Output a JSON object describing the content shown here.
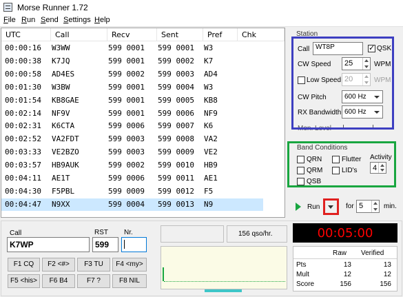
{
  "window": {
    "title": "Morse Runner 1.72"
  },
  "menu": [
    "File",
    "Run",
    "Send",
    "Settings",
    "Help"
  ],
  "log": {
    "columns": [
      "UTC",
      "Call",
      "Recv",
      "Sent",
      "Pref",
      "Chk"
    ],
    "rows": [
      [
        "00:00:16",
        "W3WW",
        "599 0001",
        "599 0001",
        "W3",
        ""
      ],
      [
        "00:00:38",
        "K7JQ",
        "599 0001",
        "599 0002",
        "K7",
        ""
      ],
      [
        "00:00:58",
        "AD4ES",
        "599 0002",
        "599 0003",
        "AD4",
        ""
      ],
      [
        "00:01:30",
        "W3BW",
        "599 0001",
        "599 0004",
        "W3",
        ""
      ],
      [
        "00:01:54",
        "KB8GAE",
        "599 0001",
        "599 0005",
        "KB8",
        ""
      ],
      [
        "00:02:14",
        "NF9V",
        "599 0001",
        "599 0006",
        "NF9",
        ""
      ],
      [
        "00:02:31",
        "K6CTA",
        "599 0006",
        "599 0007",
        "K6",
        ""
      ],
      [
        "00:02:52",
        "VA2FDT",
        "599 0003",
        "599 0008",
        "VA2",
        ""
      ],
      [
        "00:03:33",
        "VE2BZO",
        "599 0003",
        "599 0009",
        "VE2",
        ""
      ],
      [
        "00:03:57",
        "HB9AUK",
        "599 0002",
        "599 0010",
        "HB9",
        ""
      ],
      [
        "00:04:11",
        "AE1T",
        "599 0006",
        "599 0011",
        "AE1",
        ""
      ],
      [
        "00:04:30",
        "F5PBL",
        "599 0009",
        "599 0012",
        "F5",
        ""
      ],
      [
        "00:04:47",
        "N9XX",
        "599 0004",
        "599 0013",
        "N9",
        ""
      ]
    ]
  },
  "station": {
    "group_label": "Station",
    "call_label": "Call",
    "call_value": "WT8P",
    "qsk_label": "QSK",
    "qsk_checked": true,
    "cw_speed_label": "CW Speed",
    "cw_speed_value": "25",
    "wpm_label": "WPM",
    "low_speed_label": "Low Speed",
    "low_speed_checked": false,
    "low_speed_value": "20",
    "low_wpm_label": "WPM",
    "cw_pitch_label": "CW Pitch",
    "cw_pitch_value": "600 Hz",
    "rx_bw_label": "RX Bandwidth",
    "rx_bw_value": "600 Hz",
    "mon_level_label": "Mon. Level"
  },
  "band": {
    "group_label": "Band Conditions",
    "qrn_label": "QRN",
    "qrm_label": "QRM",
    "qsb_label": "QSB",
    "flutter_label": "Flutter",
    "lids_label": "LID's",
    "activity_label": "Activity",
    "activity_value": "4"
  },
  "run": {
    "run_label": "Run",
    "for_label": "for",
    "minutes_value": "5",
    "min_label": "min."
  },
  "entry": {
    "call_label": "Call",
    "call_value": "K7WP",
    "rst_label": "RST",
    "rst_value": "599",
    "nr_label": "Nr.",
    "nr_value": ""
  },
  "fkeys": [
    "F1 CQ",
    "F2 <#>",
    "F3 TU",
    "F4 <my>",
    "F5 <his>",
    "F6 B4",
    "F7 ?",
    "F8 NIL"
  ],
  "rate": {
    "text": "156 qso/hr."
  },
  "timer": {
    "value": "00:05:00"
  },
  "score": {
    "headers": [
      "",
      "Raw",
      "Verified"
    ],
    "rows": [
      [
        "Pts",
        "13",
        "13"
      ],
      [
        "Mult",
        "12",
        "12"
      ],
      [
        "Score",
        "156",
        "156"
      ]
    ]
  },
  "colors": {
    "timer_bg": "#000000",
    "timer_fg": "#ff0000",
    "selected_row": "#cce8ff",
    "highlight_blue": "#3d3fc1",
    "highlight_green": "#19a640",
    "highlight_red": "#e0201f"
  }
}
